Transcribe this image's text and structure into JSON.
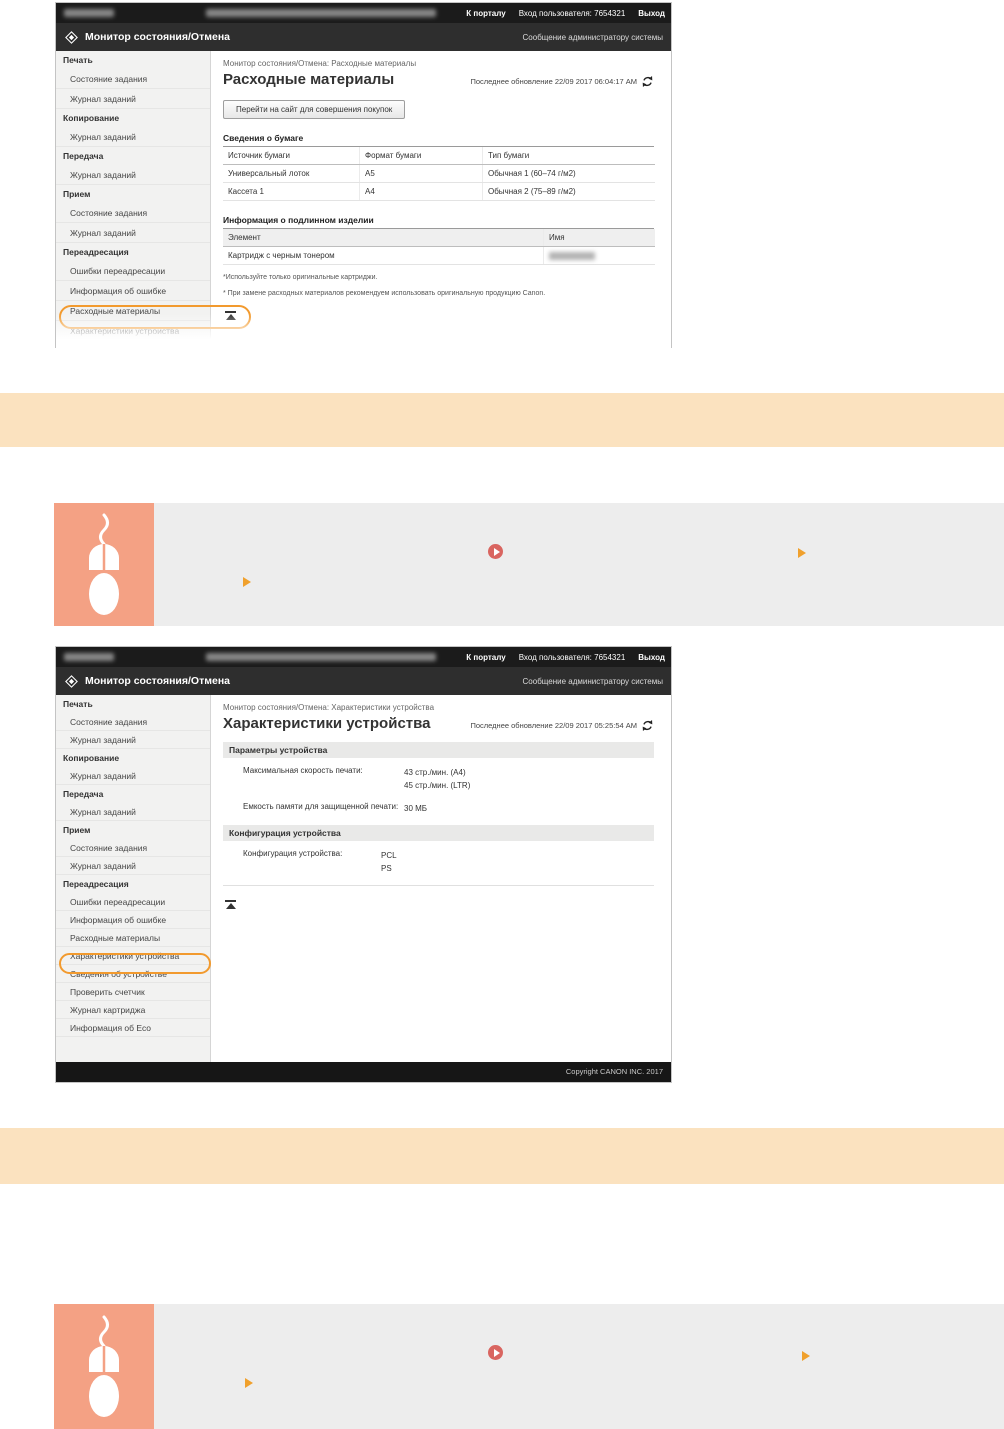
{
  "colors": {
    "accent_orange": "#f29a2e",
    "band_peach": "#fbe2bf",
    "mouse_salmon": "#f4a184",
    "step_gray": "#ededed",
    "link_red": "#d96560",
    "header_dark": "#2e2e2e"
  },
  "topbar": {
    "portal": "К порталу",
    "login": "Вход пользователя:",
    "user_id": "7654321",
    "logout": "Выход"
  },
  "titlebar": {
    "title": "Монитор состояния/Отмена",
    "admin_link": "Сообщение администратору системы"
  },
  "sidebar_items": [
    {
      "label": "Печать",
      "type": "header"
    },
    {
      "label": "Состояние задания",
      "type": "link"
    },
    {
      "label": "Журнал заданий",
      "type": "link"
    },
    {
      "label": "Копирование",
      "type": "header"
    },
    {
      "label": "Журнал заданий",
      "type": "link"
    },
    {
      "label": "Передача",
      "type": "header"
    },
    {
      "label": "Журнал заданий",
      "type": "link"
    },
    {
      "label": "Прием",
      "type": "header"
    },
    {
      "label": "Состояние задания",
      "type": "link"
    },
    {
      "label": "Журнал заданий",
      "type": "link"
    },
    {
      "label": "Переадресация",
      "type": "header"
    },
    {
      "label": "Ошибки переадресации",
      "type": "link"
    },
    {
      "label": "Информация об ошибке",
      "type": "link"
    },
    {
      "label": "Расходные материалы",
      "type": "link"
    },
    {
      "label": "Характеристики устройства",
      "type": "link"
    },
    {
      "label": "Сведения об устройстве",
      "type": "link"
    },
    {
      "label": "Проверить счетчик",
      "type": "link"
    },
    {
      "label": "Журнал картриджа",
      "type": "link"
    },
    {
      "label": "Информация об Eco",
      "type": "link"
    }
  ],
  "screenshot1": {
    "breadcrumb": "Монитор состояния/Отмена: Расходные материалы",
    "page_title": "Расходные материалы",
    "last_update": "Последнее обновление 22/09 2017 06:04:17 AM",
    "shop_button": "Перейти на сайт для совершения покупок",
    "paper": {
      "title": "Сведения о бумаге",
      "col1": "Источник бумаги",
      "col2": "Формат бумаги",
      "col3": "Тип бумаги",
      "rows": [
        {
          "source": "Универсальный лоток",
          "format": "A5",
          "type": "Обычная 1 (60–74 г/м2)"
        },
        {
          "source": "Кассета 1",
          "format": "A4",
          "type": "Обычная 2 (75–89 г/м2)"
        }
      ]
    },
    "genuine": {
      "title": "Информация о подлинном изделии",
      "col1": "Элемент",
      "col2": "Имя",
      "row_item": "Картридж с черным тонером"
    },
    "note1": "*Используйте только оригинальные картриджи.",
    "note2": "* При замене расходных материалов рекомендуем использовать оригинальную продукцию Canon."
  },
  "screenshot2": {
    "breadcrumb": "Монитор состояния/Отмена: Характеристики устройства",
    "page_title": "Характеристики устройства",
    "last_update": "Последнее обновление 22/09 2017 05:25:54 AM",
    "params": {
      "title": "Параметры устройства",
      "speed_label": "Максимальная скорость печати:",
      "speed_a4": "43 стр./мин. (A4)",
      "speed_ltr": "45 стр./мин. (LTR)",
      "memory_label": "Емкость памяти для защищенной печати:",
      "memory_value": "30 МБ"
    },
    "config": {
      "title": "Конфигурация устройства",
      "label": "Конфигурация устройства:",
      "value1": "PCL",
      "value2": "PS"
    },
    "footer": "Copyright CANON INC.  2017"
  }
}
